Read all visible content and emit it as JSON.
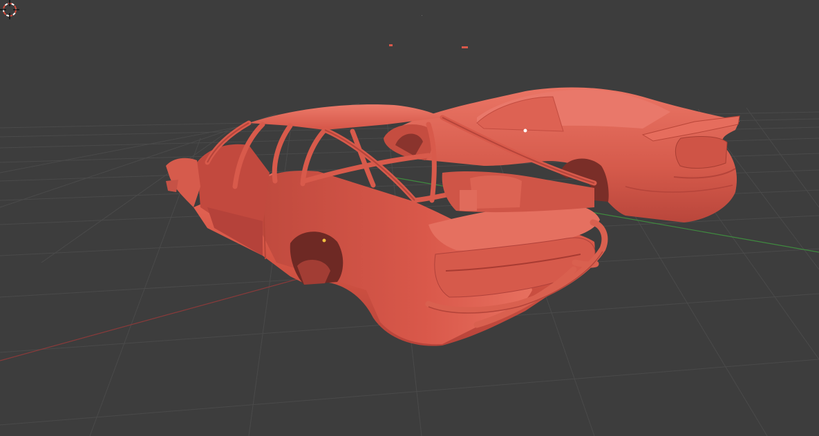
{
  "viewport": {
    "mode": "3d-viewport",
    "background_color": "#3d3d3d",
    "grid_color": "#4a4a4a",
    "x_axis_color": "#8a3a3a",
    "y_axis_color": "#3f8a3f",
    "shading": "solid",
    "objects": [
      {
        "name": "car-body-shell-with-roll-cage",
        "color": "#d9584a"
      },
      {
        "name": "car-body-shell-rear",
        "color": "#d9584a"
      }
    ],
    "cursor_icon": "3d-cursor-icon"
  }
}
